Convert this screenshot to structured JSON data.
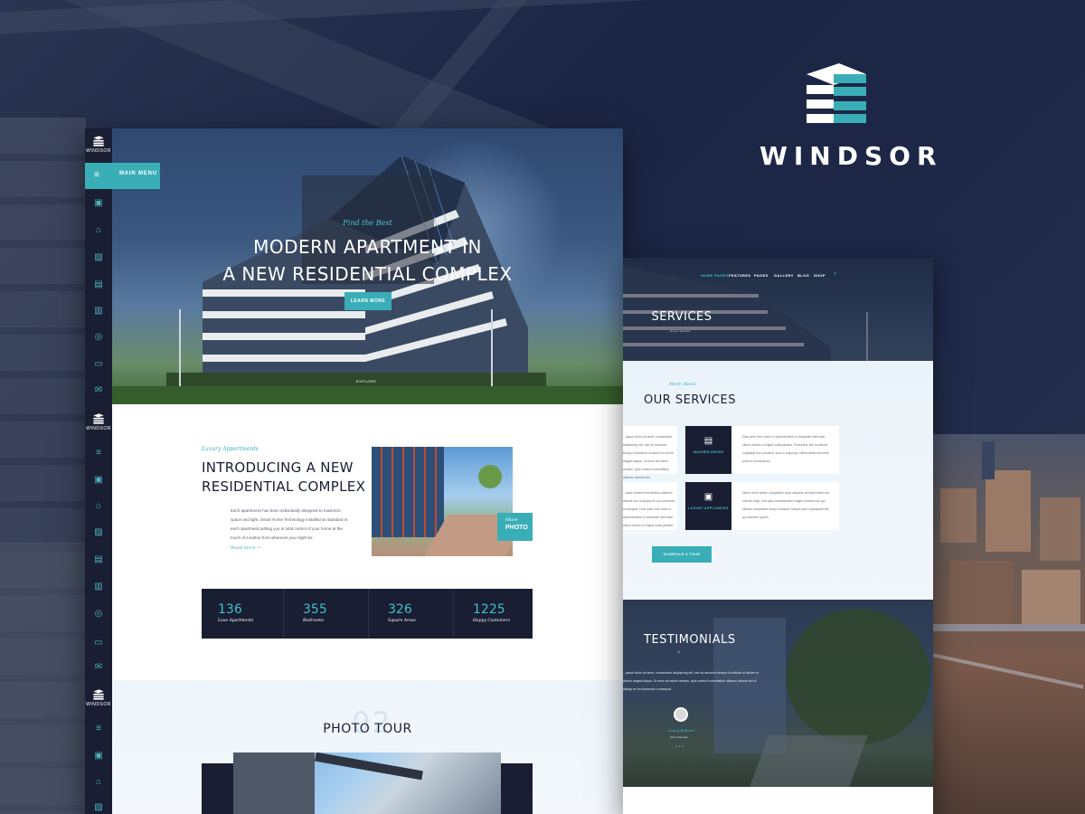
{
  "brand": {
    "name": "WINDSOR",
    "accent": "#3aaeb7",
    "dark": "#1a1e33"
  },
  "sidebar": {
    "logo_text": "WINDSOR",
    "menu_label": "MAIN MENU",
    "icons": [
      "calendar-icon",
      "home-icon",
      "image-icon",
      "clipboard-icon",
      "film-icon",
      "user-icon",
      "id-card-icon",
      "mail-icon"
    ]
  },
  "hero": {
    "kicker": "Find the Best",
    "title_line1": "MODERN APARTMENT IN",
    "title_line2": "A NEW RESIDENTIAL COMPLEX",
    "button": "LEARN MORE",
    "scroll": "EXPLORE"
  },
  "intro": {
    "kicker": "Luxury Appartments",
    "title_line1": "INTRODUCING A NEW",
    "title_line2": "RESIDENTIAL COMPLEX",
    "paragraph": "Each apartments has been individually designed to maximize space and light. Smart Home Technology installed as standard in each apartment putting you in total control of your home at the touch of a button from wherever you might be.",
    "read_more": "Read more →",
    "more_photo_top": "More",
    "more_photo_bottom": "PHOTO"
  },
  "stats": [
    {
      "value": "136",
      "label": "Luxe Apartments"
    },
    {
      "value": "355",
      "label": "Bedrooms"
    },
    {
      "value": "326",
      "label": "Square Areas"
    },
    {
      "value": "1225",
      "label": "Happy Customers"
    }
  ],
  "tour": {
    "number": "02",
    "title": "PHOTO TOUR"
  },
  "services_page": {
    "nav": [
      "HOME PAGES",
      "FEATURES",
      "PAGES",
      "GALLERY",
      "BLOG",
      "SHOP"
    ],
    "header_title": "SERVICES",
    "breadcrumb": "Home / Services",
    "kicker": "More About",
    "title": "OUR SERVICES",
    "card1_text": "...ipsum dolor sit amet, consectetur adipisicing elit, sed do eiusmod tempor incididunt ut labore et dolore magna aliqua. Ut enim ad minim veniam, quis nostrud exercitation ullamco laboris nisi.",
    "card2_label": "WASHER-DRYER",
    "card2_text": "Duis aute irure dolor in reprehenderit in voluptate velit esse cillum dolore eu fugiat nulla pariatur. Excepteur sint occaecat cupidatat non proident, sunt in culpa qui officia deserunt mollit anim id est laborum.",
    "card3_text": "...aptic nostrud exercitation ullamco laboris nisi ut aliquip ex ea commodo consequat. Duis aute irure dolor in reprehenderit in voluptate velit esse cillum dolore eu fugiat nulla pariatur.",
    "card4_label": "LUXURY APPLIANCES",
    "card4_text": "Nemo enim ipsam voluptatem quia voluptas sit aspernatur aut odit aut fugit, sed quia consequuntur magni dolores eos qui ratione voluptatem sequi nesciunt. Neque porro quisquam est, qui dolorem ipsum.",
    "button": "SCHEDULE A TOUR",
    "testimonials_title": "TESTIMONIALS",
    "quote": "...ipsum dolor sit amet, consectetur adipisicing elit, sed do eiusmod tempor incididunt ut labore et dolore magna aliqua. Ut enim ad minim veniam, quis nostrud exercitation ullamco laboris nisi ut aliquip ex ea commodo consequat.",
    "author": "Irving Rolland",
    "role": "Sales Manager"
  }
}
